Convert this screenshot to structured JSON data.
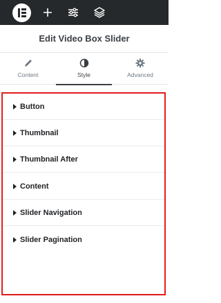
{
  "toolbar": {
    "logo": "elementor-logo",
    "icons": [
      "plus-icon",
      "sliders-icon",
      "layers-icon"
    ]
  },
  "panel": {
    "title": "Edit Video Box Slider"
  },
  "tabs": [
    {
      "label": "Content",
      "icon": "pencil-icon",
      "active": false
    },
    {
      "label": "Style",
      "icon": "contrast-icon",
      "active": true
    },
    {
      "label": "Advanced",
      "icon": "gear-icon",
      "active": false
    }
  ],
  "sections": [
    {
      "label": "Button"
    },
    {
      "label": "Thumbnail"
    },
    {
      "label": "Thumbnail After"
    },
    {
      "label": "Content"
    },
    {
      "label": "Slider Navigation"
    },
    {
      "label": "Slider Pagination"
    }
  ],
  "colors": {
    "toolbar_bg": "#26292c",
    "highlight": "#e21b1b",
    "text_dark": "#1f2124",
    "text_muted": "#6d7882"
  }
}
